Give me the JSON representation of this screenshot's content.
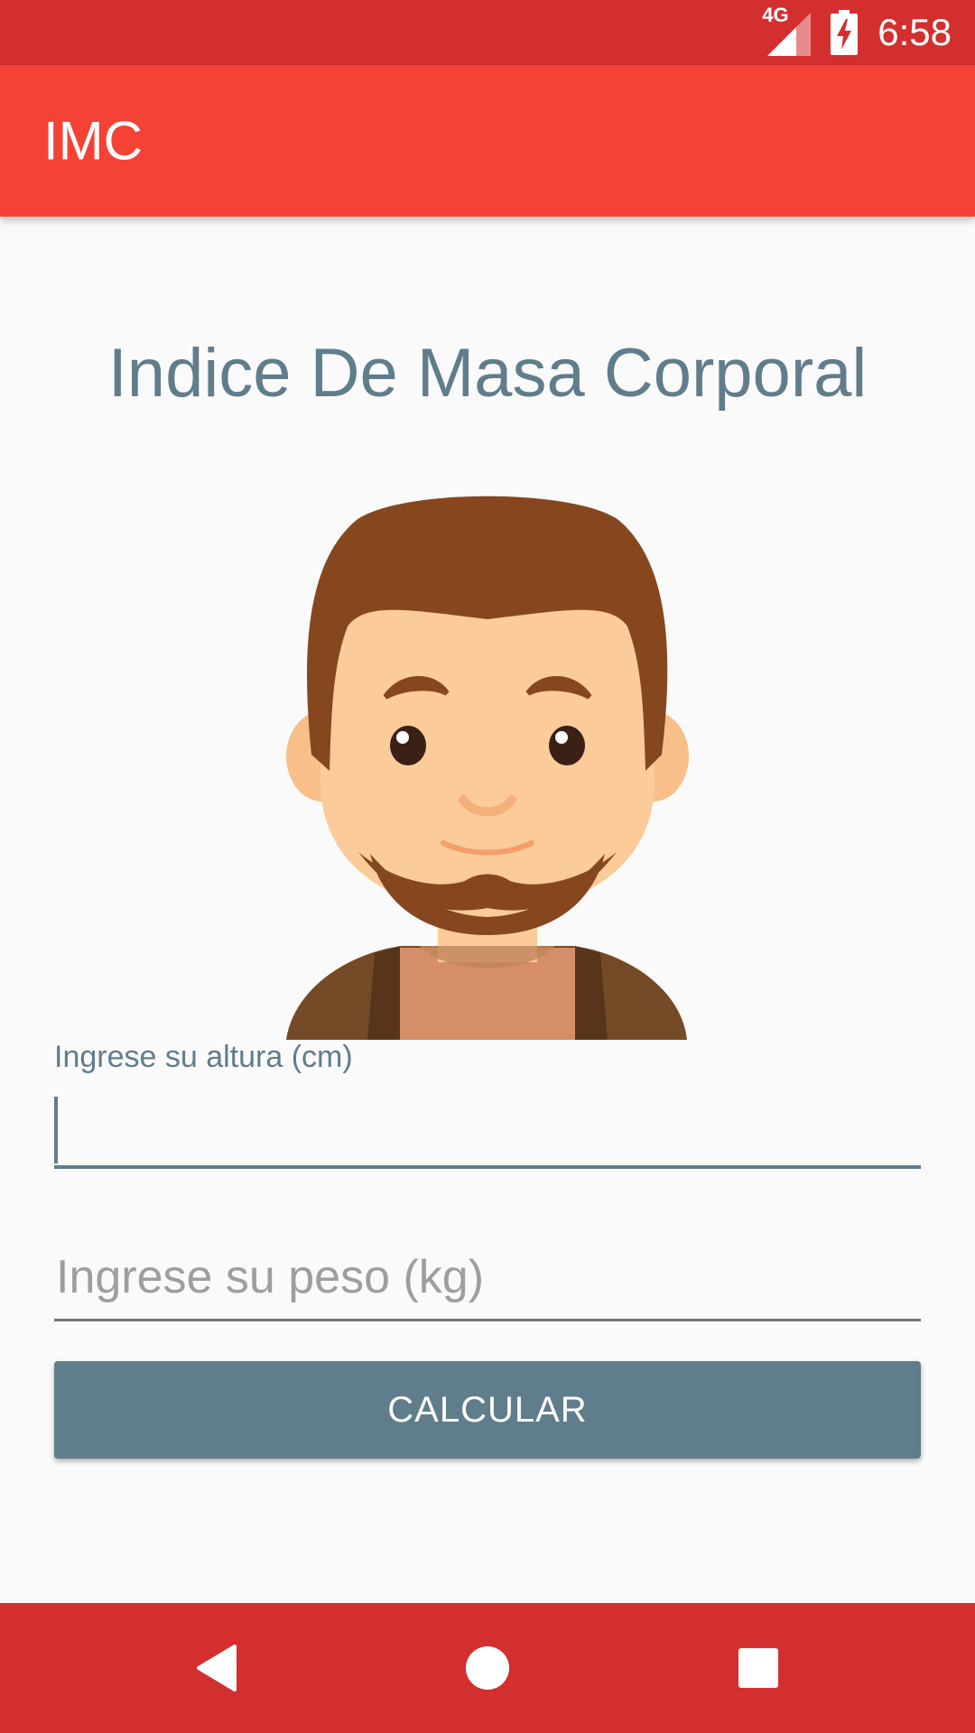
{
  "status_bar": {
    "network": "4G",
    "time": "6:58",
    "color": "#d32f2f"
  },
  "app_bar": {
    "title": "IMC",
    "color": "#f44336"
  },
  "main": {
    "title": "Indice De Masa Corporal",
    "avatar_icon": "man-avatar-illustration",
    "height_field": {
      "label": "Ingrese su altura (cm)",
      "value": ""
    },
    "weight_field": {
      "placeholder": "Ingrese su peso (kg)",
      "value": ""
    },
    "calculate_button": "CALCULAR",
    "accent": "#607d8b"
  },
  "nav_bar": {
    "icons": [
      "back-icon",
      "home-icon",
      "recents-icon"
    ]
  }
}
